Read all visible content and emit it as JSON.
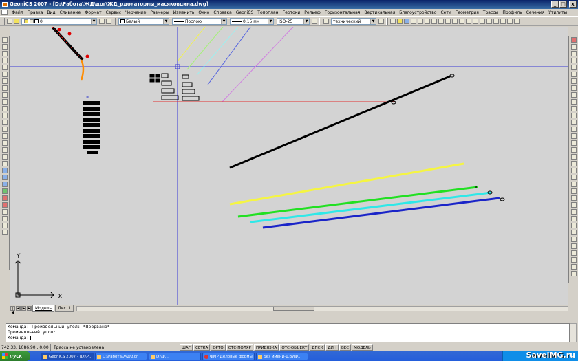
{
  "window": {
    "title": "GeoniCS 2007 - [D:\\Работа\\ЖД\\дог\\ЖД_рдонаторны_масяковцина.dwg]",
    "buttons": [
      "_",
      "□",
      "x"
    ]
  },
  "menu": [
    "Файл",
    "Правка",
    "Вид",
    "Сливание",
    "Формат",
    "Сервис",
    "Черчение",
    "Размеры",
    "Изменить",
    "Окно",
    "Справка",
    "GeoniCS",
    "Топоплан",
    "Геотоки",
    "Рельеф",
    "Горизонтальная",
    "Вертикальная",
    "Благоустройство",
    "Сети",
    "Геометрия",
    "Трассы",
    "Профиль",
    "Сечения",
    "Утилиты"
  ],
  "toolbar": {
    "layer_value": "0",
    "color_value": "Белый",
    "linetype_value": "Послою",
    "lineweight_value": "0.15 мм",
    "dimstyle_value": "ISO-25",
    "textstyle_value": "технический"
  },
  "layout_tabs": [
    "Модель",
    "Лист1"
  ],
  "command_lines": [
    "Команда: Произвольный угол: *Прервано*",
    "Произвольный угол:",
    "Команда:"
  ],
  "status": {
    "coords": "742.33, 1086.90 , 0.00",
    "message": "Трасса не установлена",
    "modes": [
      "ШАГ",
      "СЕТКА",
      "ОРТО",
      "ОТС-ПОЛЯР",
      "ПРИВЯЗКА",
      "ОТС-ОБЪЕКТ",
      "ДПСК",
      "ДИН",
      "ВЕС",
      "МОДЕЛЬ"
    ]
  },
  "taskbar": {
    "start_label": "пуск",
    "tasks": [
      "GeoniCS 2007 - [D:\\Р...",
      "D:\\Работа\\ЖД\\дог",
      "D:\\Ф...",
      "ФМР Деловые формы",
      "Без имени-1.ВИФ..."
    ]
  },
  "watermark": "SaveIMG.ru",
  "ucs": {
    "x_label": "X",
    "y_label": "Y"
  },
  "colors": {
    "black_line": "#000000",
    "yellow_line": "#f5f542",
    "green_line": "#22e022",
    "cyan_line": "#2ee8e8",
    "blue_line": "#1a24c8",
    "crosshair": "#3a3ad6",
    "red_line": "#e03030"
  }
}
